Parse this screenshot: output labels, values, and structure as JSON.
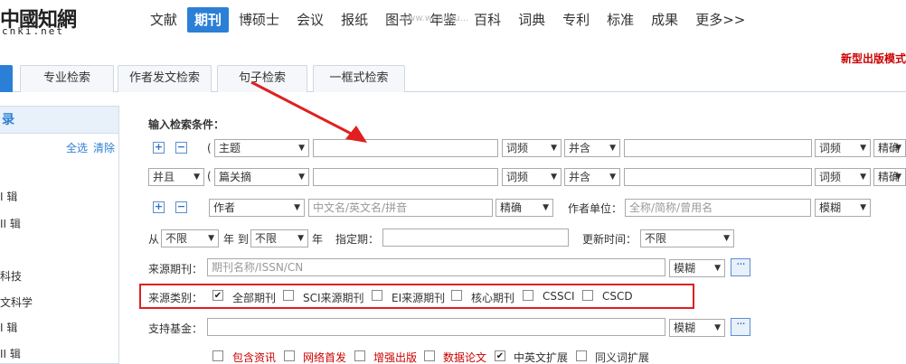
{
  "logo": {
    "title": "中國知網",
    "sub": "cnki.net"
  },
  "watermark": "www.wenchu...",
  "nav": [
    {
      "label": "文献",
      "active": false
    },
    {
      "label": "期刊",
      "active": true
    },
    {
      "label": "博硕士",
      "active": false
    },
    {
      "label": "会议",
      "active": false
    },
    {
      "label": "报纸",
      "active": false
    },
    {
      "label": "图书",
      "active": false
    },
    {
      "label": "年鉴",
      "active": false
    },
    {
      "label": "百科",
      "active": false
    },
    {
      "label": "词典",
      "active": false
    },
    {
      "label": "专利",
      "active": false
    },
    {
      "label": "标准",
      "active": false
    },
    {
      "label": "成果",
      "active": false
    },
    {
      "label": "更多>>",
      "active": false
    }
  ],
  "notice": "新型出版模式",
  "tabs": [
    "专业检索",
    "作者发文检索",
    "句子检索",
    "一框式检索"
  ],
  "sidebar": {
    "head": "录",
    "select_all": "全选",
    "clear": "清除",
    "items": [
      "",
      "I 辑",
      "II 辑",
      "",
      "科技",
      "文科学",
      "I 辑",
      "II 辑"
    ]
  },
  "form": {
    "title": "输入检索条件：",
    "row1": {
      "field": "主题",
      "freq1": "词频",
      "combine": "并含",
      "freq2": "词频",
      "match": "精确"
    },
    "row2": {
      "logic": "并且",
      "field": "篇关摘",
      "freq1": "词频",
      "combine": "并含",
      "freq2": "词频",
      "match": "精确"
    },
    "row3": {
      "field": "作者",
      "author_placeholder": "中文名/英文名/拼音",
      "match1": "精确",
      "unit_label": "作者单位：",
      "unit_placeholder": "全称/简称/曾用名",
      "match2": "模糊"
    },
    "row4": {
      "from": "从",
      "from_val": "不限",
      "year_to": "年 到",
      "to_val": "不限",
      "year": "年",
      "specify": "指定期：",
      "update_label": "更新时间：",
      "update_val": "不限"
    },
    "row5": {
      "label": "来源期刊：",
      "placeholder": "期刊名称/ISSN/CN",
      "match": "模糊"
    },
    "row6": {
      "label": "来源类别：",
      "options": [
        {
          "label": "全部期刊",
          "checked": true
        },
        {
          "label": "SCI来源期刊",
          "checked": false
        },
        {
          "label": "EI来源期刊",
          "checked": false
        },
        {
          "label": "核心期刊",
          "checked": false
        },
        {
          "label": "CSSCI",
          "checked": false
        },
        {
          "label": "CSCD",
          "checked": false
        }
      ]
    },
    "row7": {
      "label": "支持基金：",
      "match": "模糊"
    },
    "row8": [
      {
        "label": "包含资讯",
        "checked": false,
        "red": true
      },
      {
        "label": "网络首发",
        "checked": false,
        "red": true
      },
      {
        "label": "增强出版",
        "checked": false,
        "red": true
      },
      {
        "label": "数据论文",
        "checked": false,
        "red": true
      },
      {
        "label": "中英文扩展",
        "checked": true,
        "red": false
      },
      {
        "label": "同义词扩展",
        "checked": false,
        "red": false
      }
    ],
    "plus": "+",
    "minus": "−",
    "paren": "(",
    "dots": "···"
  },
  "colors": {
    "accent": "#2c7fd6",
    "annotation": "#e02020"
  }
}
